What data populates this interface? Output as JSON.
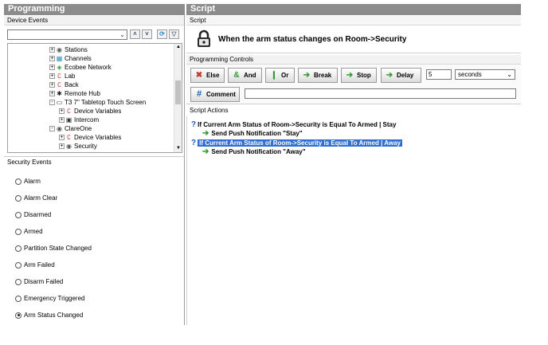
{
  "left": {
    "title": "Programming",
    "device_events_label": "Device Events",
    "filter": {
      "value": ""
    },
    "tree": [
      {
        "label": "Stations",
        "icon": "stations-icon",
        "expander": "+"
      },
      {
        "label": "Channels",
        "icon": "channels-icon",
        "expander": "+"
      },
      {
        "label": "Ecobee Network",
        "icon": "ecobee-icon",
        "expander": "+"
      },
      {
        "label": "Lab",
        "icon": "lab-icon",
        "expander": "+"
      },
      {
        "label": "Back",
        "icon": "back-icon",
        "expander": "+"
      },
      {
        "label": "Remote Hub",
        "icon": "remote-hub-icon",
        "expander": "+"
      },
      {
        "label": "T3 7\" Tabletop Touch Screen",
        "icon": "touch-screen-icon",
        "expander": "-"
      },
      {
        "label": "Device Variables",
        "icon": "device-variables-icon",
        "expander": "+"
      },
      {
        "label": "Intercom",
        "icon": "intercom-icon",
        "expander": "+"
      },
      {
        "label": "ClareOne",
        "icon": "clareone-icon",
        "expander": "-"
      },
      {
        "label": "Device Variables",
        "icon": "device-variables-icon",
        "expander": "+"
      },
      {
        "label": "Security",
        "icon": "security-icon",
        "expander": "+"
      }
    ],
    "security_events_label": "Security Events",
    "security_events": [
      {
        "label": "Alarm",
        "selected": false
      },
      {
        "label": "Alarm Clear",
        "selected": false
      },
      {
        "label": "Disarmed",
        "selected": false
      },
      {
        "label": "Armed",
        "selected": false
      },
      {
        "label": "Partition State Changed",
        "selected": false
      },
      {
        "label": "Arm Failed",
        "selected": false
      },
      {
        "label": "Disarm Failed",
        "selected": false
      },
      {
        "label": "Emergency Triggered",
        "selected": false
      },
      {
        "label": "Arm Status Changed",
        "selected": true
      }
    ]
  },
  "right": {
    "title": "Script",
    "script_label": "Script",
    "trigger_text": "When the arm status changes on Room->Security",
    "controls_label": "Programming Controls",
    "buttons": {
      "else": "Else",
      "and": "And",
      "or": "Or",
      "break": "Break",
      "stop": "Stop",
      "delay": "Delay",
      "comment": "Comment"
    },
    "delay_value": "5",
    "delay_unit": "seconds",
    "comment_value": "",
    "actions_label": "Script Actions",
    "actions": [
      {
        "condition": "If Current Arm Status of Room->Security is Equal To Armed | Stay",
        "action": "Send Push Notification \"Stay\"",
        "selected": false
      },
      {
        "condition": "If Current Arm Status of Room->Security is Equal To Armed | Away",
        "action": "Send Push Notification \"Away\"",
        "selected": true
      }
    ]
  },
  "colors": {
    "header": "#8c8c8c",
    "selection": "#2f6fd1",
    "question": "#1b5fb4",
    "arrow": "#2e9b2e"
  }
}
